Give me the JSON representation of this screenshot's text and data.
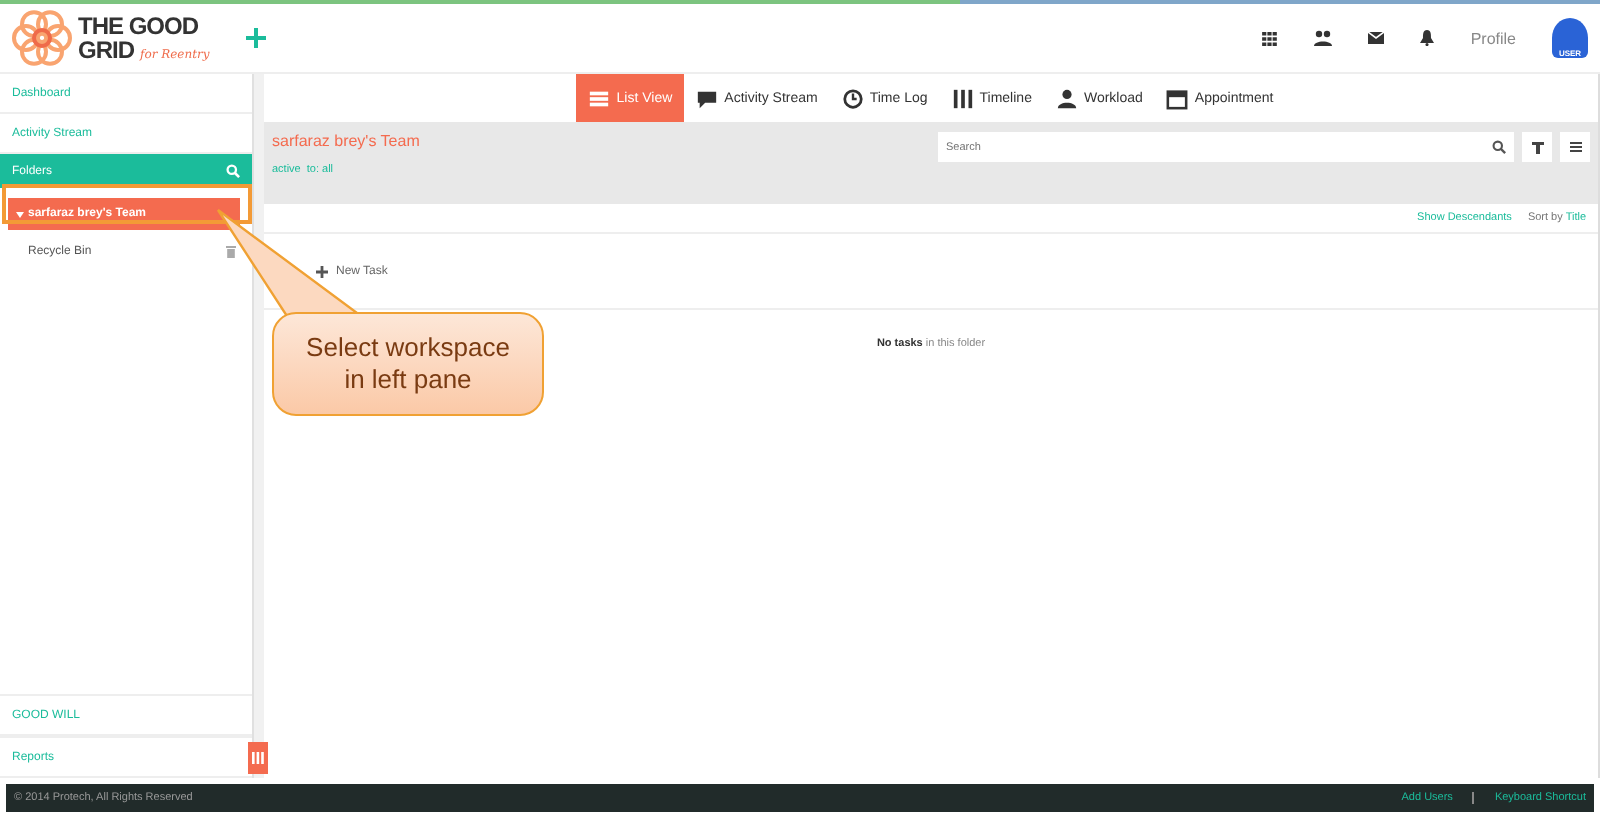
{
  "logo": {
    "line1": "THE GOOD",
    "line2": "GRID",
    "tagline": "for Reentry"
  },
  "header": {
    "profile": "Profile",
    "avatar_label": "USER"
  },
  "sidebar": {
    "top_items": [
      {
        "label": "Dashboard"
      },
      {
        "label": "Activity Stream"
      }
    ],
    "folders": {
      "label": "Folders"
    },
    "tree": [
      {
        "label": "sarfaraz brey's Team",
        "selected": true,
        "expanded": true
      },
      {
        "label": "Recycle Bin",
        "selected": false,
        "expanded": false
      }
    ],
    "bottom_items": [
      {
        "label": "GOOD WILL"
      },
      {
        "label": "Reports"
      }
    ]
  },
  "tabs": [
    {
      "label": "List View",
      "selected": true
    },
    {
      "label": "Activity Stream",
      "selected": false
    },
    {
      "label": "Time Log",
      "selected": false
    },
    {
      "label": "Timeline",
      "selected": false
    },
    {
      "label": "Workload",
      "selected": false
    },
    {
      "label": "Appointment",
      "selected": false
    }
  ],
  "team": {
    "title": "sarfaraz brey's Team",
    "filters": [
      "active",
      "to: all"
    ]
  },
  "search": {
    "placeholder": "Search"
  },
  "options": {
    "show_descendants": "Show Descendants",
    "sort_label": "Sort by",
    "sort_value": "Title"
  },
  "new_task": "New Task",
  "empty": {
    "bold": "No tasks",
    "rest": "in this folder"
  },
  "callout": "Select workspace in left pane",
  "footer": {
    "copyright": "© 2014 Protech, All Rights Reserved",
    "links": [
      "Add Users",
      "Keyboard Shortcut"
    ]
  }
}
